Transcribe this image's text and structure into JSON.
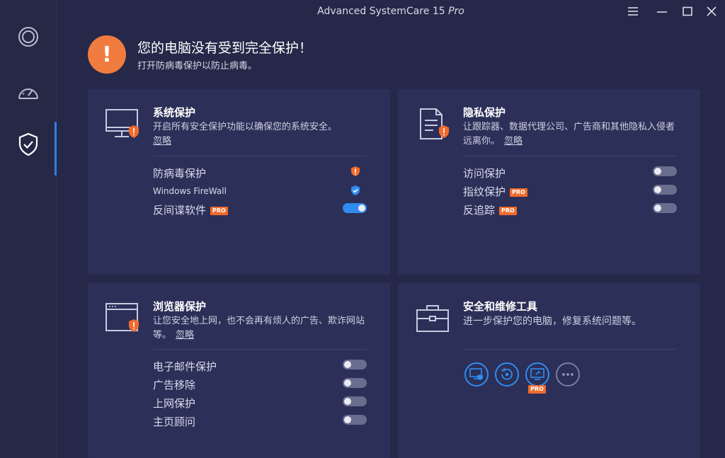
{
  "app": {
    "title_main": "Advanced SystemCare 15",
    "title_edition": "Pro",
    "menu_icon": "hamburger-menu-icon",
    "minimize_icon": "minimize-icon",
    "maximize_icon": "maximize-icon",
    "close_icon": "close-icon"
  },
  "sidebar": {
    "items": [
      {
        "icon": "care-ring-icon",
        "active": false
      },
      {
        "icon": "speedometer-icon",
        "active": false
      },
      {
        "icon": "shield-check-icon",
        "active": true
      }
    ]
  },
  "alert": {
    "icon": "exclamation-icon",
    "title": "您的电脑没有受到完全保护！",
    "subtitle": "打开防病毒保护以防止病毒。",
    "color": "#f07b3f"
  },
  "cards": {
    "system": {
      "title": "系统保护",
      "desc": "开启所有安全保护功能以确保您的系统安全。",
      "ignore": "忽略",
      "rows": [
        {
          "label": "防病毒保护",
          "status": "warning"
        },
        {
          "label": "Windows FireWall",
          "status": "ok"
        },
        {
          "label": "反间谍软件",
          "pro": "PRO",
          "toggle": "on"
        }
      ]
    },
    "privacy": {
      "title": "隐私保护",
      "desc": "让跟踪器、数据代理公司、广告商和其他隐私入侵者远离你。",
      "ignore": "忽略",
      "rows": [
        {
          "label": "访问保护",
          "toggle": "off"
        },
        {
          "label": "指纹保护",
          "pro": "PRO",
          "toggle": "off"
        },
        {
          "label": "反追踪",
          "pro": "PRO",
          "toggle": "off"
        }
      ]
    },
    "browser": {
      "title": "浏览器保护",
      "desc": "让您安全地上网，也不会再有烦人的广告、欺诈网站等。",
      "ignore": "忽略",
      "rows": [
        {
          "label": "电子邮件保护",
          "toggle": "off"
        },
        {
          "label": "广告移除",
          "toggle": "off"
        },
        {
          "label": "上网保护",
          "toggle": "off"
        },
        {
          "label": "主页顾问",
          "toggle": "off"
        }
      ]
    },
    "tools": {
      "title": "安全和维修工具",
      "desc": "进一步保护您的电脑，修复系统问题等。",
      "items": [
        {
          "icon": "monitor-shield-icon"
        },
        {
          "icon": "restore-icon"
        },
        {
          "icon": "monitor-scan-icon",
          "pro": "PRO"
        },
        {
          "icon": "more-icon"
        }
      ]
    }
  },
  "colors": {
    "background": "#252848",
    "card": "#2c2f57",
    "accent": "#2f8cf0",
    "warning": "#f07b3f"
  }
}
